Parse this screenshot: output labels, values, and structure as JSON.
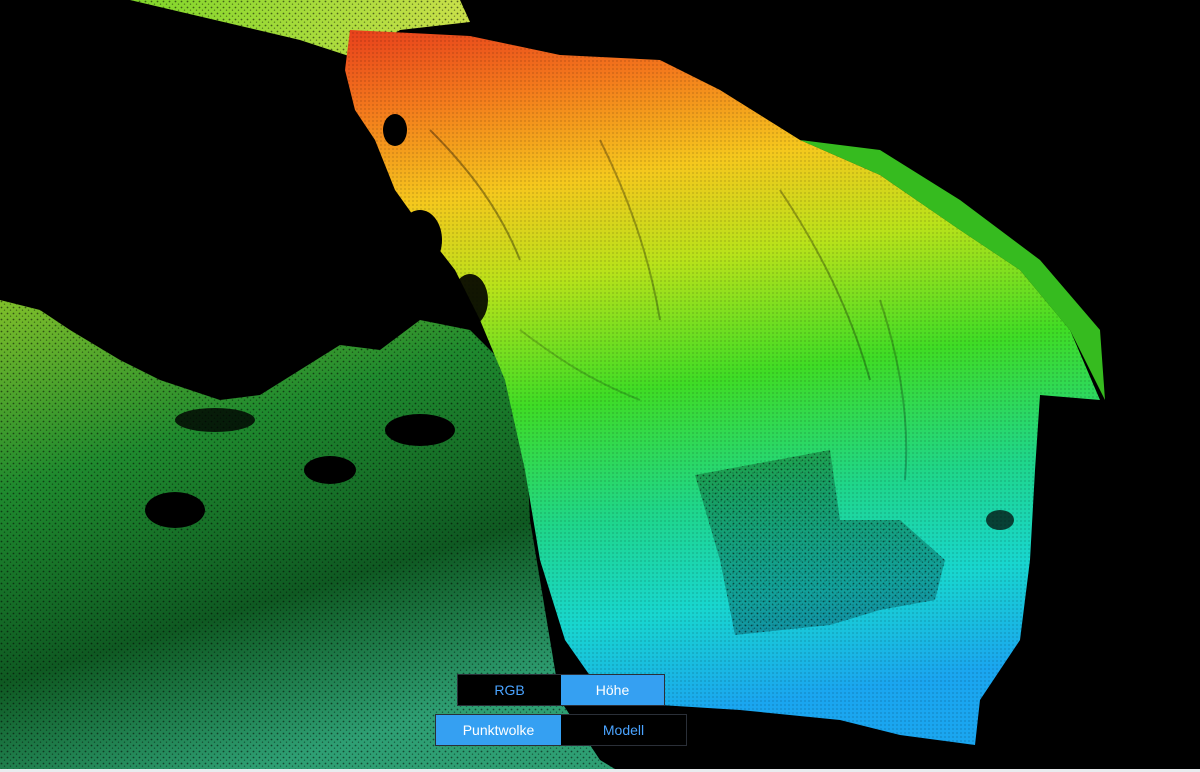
{
  "viewer": {
    "render_mode": "point-cloud",
    "color_mode": "height",
    "colors": {
      "background": "#000000",
      "height_ramp": [
        "#e8401c",
        "#f47c1c",
        "#f5c81d",
        "#b9e21a",
        "#3fdc25",
        "#1fd68a",
        "#18d6cf",
        "#1aa6f0"
      ],
      "terrain": [
        "#0b3a12",
        "#1f8a2e",
        "#2e9f73"
      ]
    }
  },
  "color_toggle": {
    "options": [
      {
        "label": "RGB",
        "active": false
      },
      {
        "label": "Höhe",
        "active": true
      }
    ]
  },
  "mode_toggle": {
    "options": [
      {
        "label": "Punktwolke",
        "active": true
      },
      {
        "label": "Modell",
        "active": false
      }
    ]
  },
  "ui_colors": {
    "active_bg": "#35a0f2",
    "inactive_text": "#4aa3ff",
    "border": "#2a2f38"
  }
}
